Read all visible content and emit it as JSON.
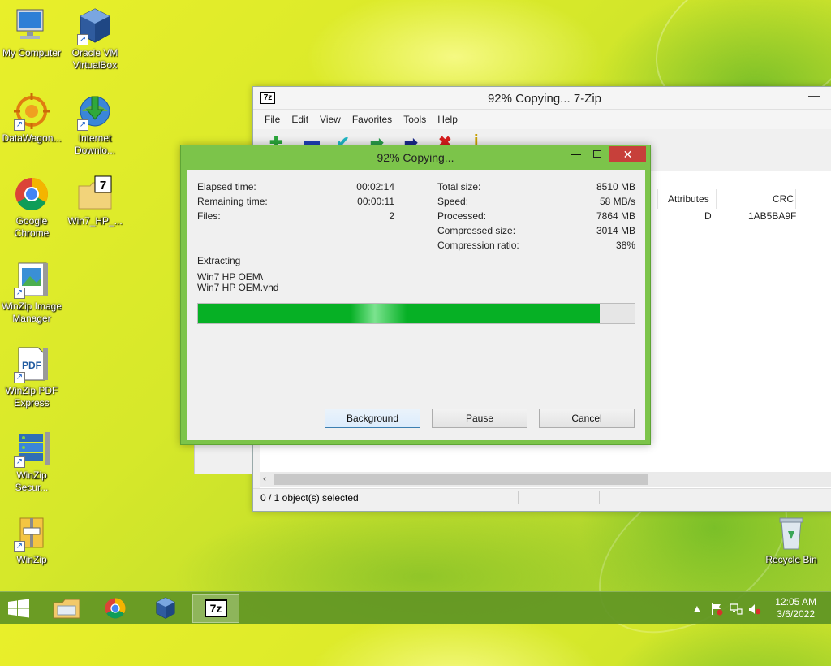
{
  "desktop": {
    "icons": [
      {
        "label": "My Computer"
      },
      {
        "label": "Oracle VM VirtualBox"
      },
      {
        "label": "DataWagon..."
      },
      {
        "label": "Internet Downlo..."
      },
      {
        "label": "Google Chrome"
      },
      {
        "label": "Win7_HP_..."
      },
      {
        "label": "WinZip Image Manager"
      },
      {
        "label": "WinZip PDF Express"
      },
      {
        "label": "WinZip Secur..."
      },
      {
        "label": "WinZip"
      },
      {
        "label": "Recycle Bin"
      }
    ]
  },
  "main_window": {
    "title": "92% Copying... 7-Zip",
    "app_icon": "7z",
    "menu": [
      "File",
      "Edit",
      "View",
      "Favorites",
      "Tools",
      "Help"
    ],
    "columns": {
      "attributes": "Attributes",
      "crc": "CRC"
    },
    "row": {
      "attributes": "D",
      "crc": "1AB5BA9F"
    },
    "status": "0 / 1 object(s) selected"
  },
  "progress_dialog": {
    "title": "92% Copying...",
    "left": [
      {
        "label": "Elapsed time:",
        "value": "00:02:14"
      },
      {
        "label": "Remaining time:",
        "value": "00:00:11"
      },
      {
        "label": "Files:",
        "value": "2"
      }
    ],
    "right": [
      {
        "label": "Total size:",
        "value": "8510 MB"
      },
      {
        "label": "Speed:",
        "value": "58 MB/s"
      },
      {
        "label": "Processed:",
        "value": "7864 MB"
      },
      {
        "label": "Compressed size:",
        "value": "3014 MB"
      },
      {
        "label": "Compression ratio:",
        "value": "38%"
      }
    ],
    "action": "Extracting",
    "path1": "Win7 HP OEM\\",
    "path2": "Win7 HP OEM.vhd",
    "progress_fraction": 0.92,
    "buttons": {
      "background": "Background",
      "pause": "Pause",
      "cancel": "Cancel"
    },
    "close_glyph": "✕"
  },
  "taskbar": {
    "time": "12:05 AM",
    "date": "3/6/2022",
    "pinned": [
      "file-explorer",
      "google-chrome",
      "virtualbox",
      "7-zip"
    ],
    "tray_expand": "▲"
  },
  "colors": {
    "progress": "#06b025",
    "dialog_frame": "#7cc44a",
    "close_button": "#c7403a"
  }
}
